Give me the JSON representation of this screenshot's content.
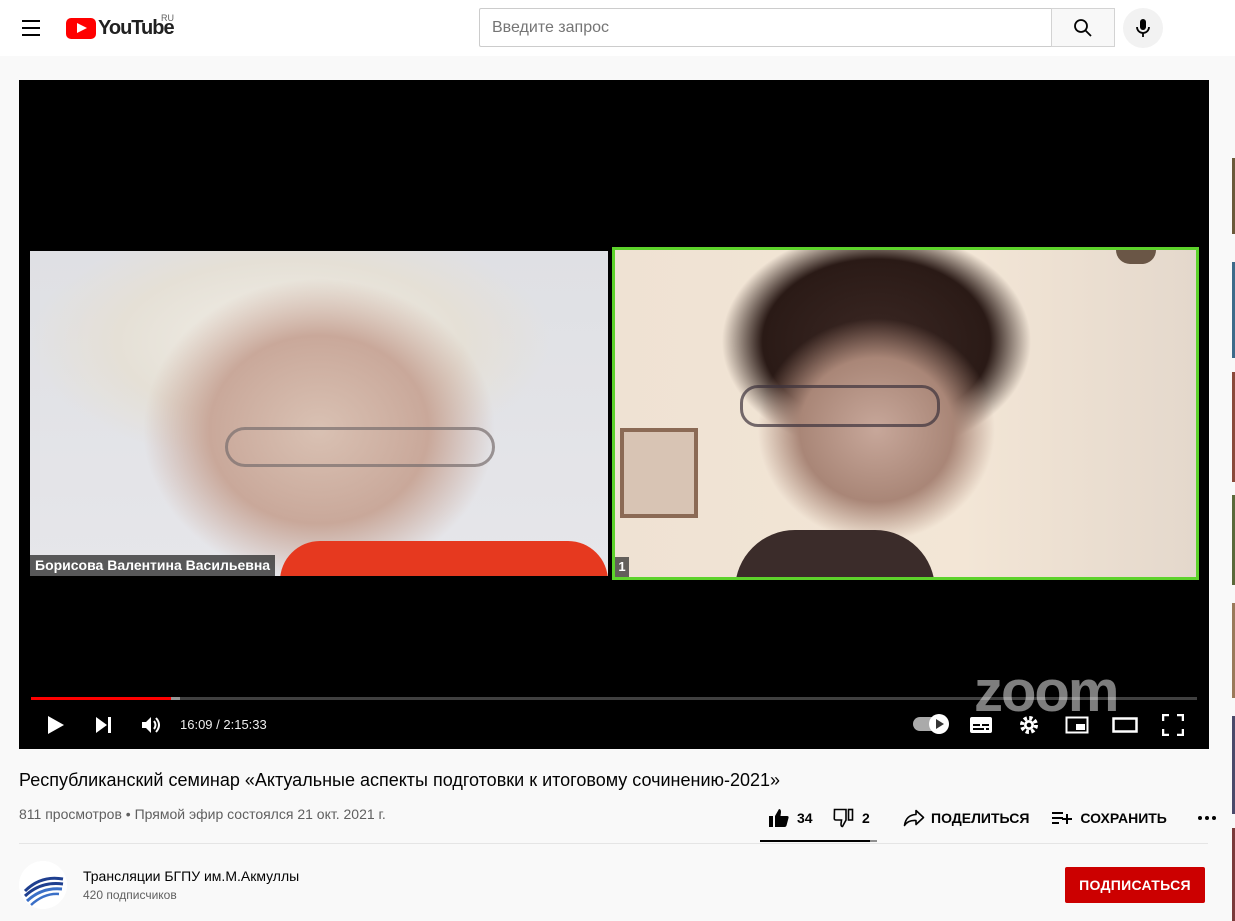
{
  "header": {
    "logo_text": "YouTube",
    "country": "RU",
    "search_placeholder": "Введите запрос"
  },
  "player": {
    "participant_left_name": "Борисова Валентина Васильевна",
    "participant_right_number": "1",
    "watermark": "zoom",
    "current_time": "16:09 / 2:15:33",
    "progress": 0.12,
    "buffered": 0.128
  },
  "video": {
    "title": "Республиканский семинар «Актуальные аспекты подготовки к итоговому сочинению-2021»",
    "meta": "811 просмотров • Прямой эфир состоялся 21 окт. 2021 г.",
    "likes": "34",
    "dislikes": "2",
    "share_label": "ПОДЕЛИТЬСЯ",
    "save_label": "СОХРАНИТЬ",
    "like_ratio": 0.944
  },
  "channel": {
    "name": "Трансляции БГПУ им.М.Акмуллы",
    "subscribers": "420 подписчиков",
    "subscribe_label": "ПОДПИСАТЬСЯ"
  },
  "colors": {
    "brand_red": "#ff0000",
    "subscribe_red": "#cc0000",
    "active_speaker": "#5dd22b"
  }
}
